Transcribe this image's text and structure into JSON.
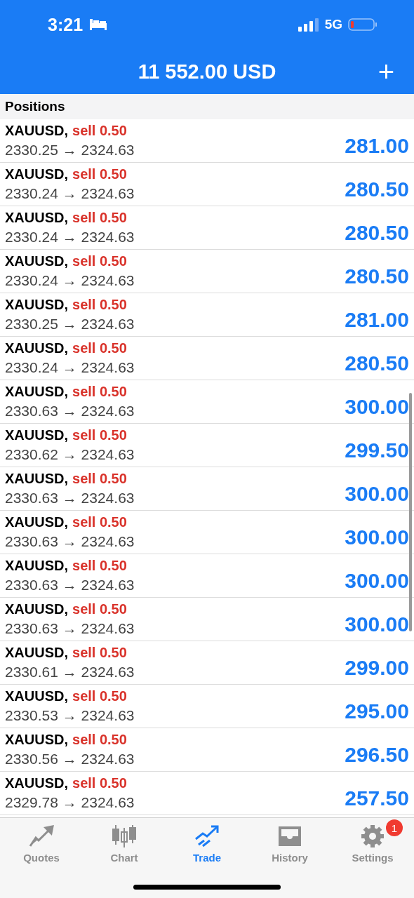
{
  "status_bar": {
    "time": "3:21",
    "network": "5G"
  },
  "header": {
    "balance": "11 552.00 USD",
    "add_button": "+"
  },
  "section": {
    "title": "Positions"
  },
  "positions": [
    {
      "symbol": "XAUUSD,",
      "order": "sell 0.50",
      "prices": "2330.25 → 2324.63",
      "profit": "281.00"
    },
    {
      "symbol": "XAUUSD,",
      "order": "sell 0.50",
      "prices": "2330.24 → 2324.63",
      "profit": "280.50"
    },
    {
      "symbol": "XAUUSD,",
      "order": "sell 0.50",
      "prices": "2330.24 → 2324.63",
      "profit": "280.50"
    },
    {
      "symbol": "XAUUSD,",
      "order": "sell 0.50",
      "prices": "2330.24 → 2324.63",
      "profit": "280.50"
    },
    {
      "symbol": "XAUUSD,",
      "order": "sell 0.50",
      "prices": "2330.25 → 2324.63",
      "profit": "281.00"
    },
    {
      "symbol": "XAUUSD,",
      "order": "sell 0.50",
      "prices": "2330.24 → 2324.63",
      "profit": "280.50"
    },
    {
      "symbol": "XAUUSD,",
      "order": "sell 0.50",
      "prices": "2330.63 → 2324.63",
      "profit": "300.00"
    },
    {
      "symbol": "XAUUSD,",
      "order": "sell 0.50",
      "prices": "2330.62 → 2324.63",
      "profit": "299.50"
    },
    {
      "symbol": "XAUUSD,",
      "order": "sell 0.50",
      "prices": "2330.63 → 2324.63",
      "profit": "300.00"
    },
    {
      "symbol": "XAUUSD,",
      "order": "sell 0.50",
      "prices": "2330.63 → 2324.63",
      "profit": "300.00"
    },
    {
      "symbol": "XAUUSD,",
      "order": "sell 0.50",
      "prices": "2330.63 → 2324.63",
      "profit": "300.00"
    },
    {
      "symbol": "XAUUSD,",
      "order": "sell 0.50",
      "prices": "2330.63 → 2324.63",
      "profit": "300.00"
    },
    {
      "symbol": "XAUUSD,",
      "order": "sell 0.50",
      "prices": "2330.61 → 2324.63",
      "profit": "299.00"
    },
    {
      "symbol": "XAUUSD,",
      "order": "sell 0.50",
      "prices": "2330.53 → 2324.63",
      "profit": "295.00"
    },
    {
      "symbol": "XAUUSD,",
      "order": "sell 0.50",
      "prices": "2330.56 → 2324.63",
      "profit": "296.50"
    },
    {
      "symbol": "XAUUSD,",
      "order": "sell 0.50",
      "prices": "2329.78 → 2324.63",
      "profit": "257.50"
    }
  ],
  "tab_bar": [
    {
      "kind": "quotes",
      "label": "Quotes",
      "selected": false
    },
    {
      "kind": "chart",
      "label": "Chart",
      "selected": false
    },
    {
      "kind": "trade",
      "label": "Trade",
      "selected": true
    },
    {
      "kind": "history",
      "label": "History",
      "selected": false
    },
    {
      "kind": "settings",
      "label": "Settings",
      "selected": false,
      "badge": "1"
    }
  ]
}
